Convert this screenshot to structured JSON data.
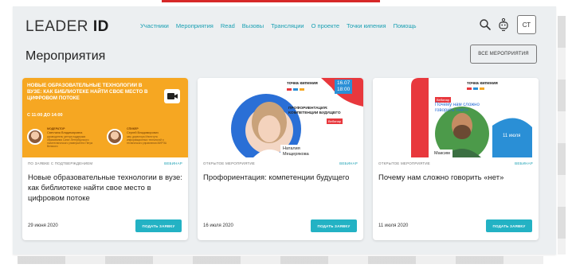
{
  "header": {
    "logo_main": "LEADER",
    "logo_accent": "ID",
    "nav": [
      "Участники",
      "Мероприятия",
      "Read",
      "Вызовы",
      "Трансляции",
      "О проекте",
      "Точки кипения",
      "Помощь"
    ],
    "avatar_initials": "СТ"
  },
  "page": {
    "title": "Мероприятия",
    "all_events_label": "ВСЕ МЕРОПРИЯТИЯ"
  },
  "cards": [
    {
      "meta_type": "ПО ЗАЯВКЕ С ПОДТВЕРЖДЕНИЕМ",
      "meta_format": "ВЕБИНАР",
      "title": "Новые образовательные технологии в вузе: как библиотеке найти свое место в цифровом потоке",
      "date": "29 июня 2020",
      "apply_label": "ПОДАТЬ ЗАЯВКУ",
      "banner": {
        "title": "НОВЫЕ ОБРАЗОВАТЕЛЬНЫЕ ТЕХНОЛОГИИ В ВУЗЕ: КАК БИБЛИОТЕКЕ НАЙТИ СВОЕ МЕСТО В ЦИФРОВОМ ПОТОКЕ",
        "time": "С 11:00 ДО 14:00",
        "speakers": [
          {
            "role": "МОДЕРАТОР",
            "name": "Светлана Владимировна",
            "desc": "руководитель центра поддержки образования Санкт-Петербургского политехнического университета Петра Великого"
          },
          {
            "role": "СПИКЕР",
            "name": "Сергей Владимирович",
            "desc": "зам. директора Института информационных технологий и технического управления МИРЭА"
          }
        ]
      }
    },
    {
      "meta_type": "ОТКРЫТОЕ МЕРОПРИЯТИЕ",
      "meta_format": "ВЕБИНАР",
      "title": "Профориентация: компетенции будущего",
      "date": "16 июля 2020",
      "apply_label": "ПОДАТЬ ЗАЯВКУ",
      "banner": {
        "logo": "точка кипения",
        "date": "16.07",
        "time": "18:00",
        "title": "ПРОФОРИЕНТАЦИЯ: КОМПЕТЕНЦИИ БУДУЩЕГО",
        "tag": "Вебинар",
        "speaker": "Наталия Мещерякова"
      }
    },
    {
      "meta_type": "ОТКРЫТОЕ МЕРОПРИЯТИЕ",
      "meta_format": "ВЕБИНАР",
      "title": "Почему нам сложно говорить «нет»",
      "date": "11 июля 2020",
      "apply_label": "ПОДАТЬ ЗАЯВКУ",
      "banner": {
        "logo": "точка кипения",
        "tag": "Вебинар",
        "title": "Почему нам сложно говорить «нет»",
        "speaker": "Максим",
        "date": "11 июля"
      }
    }
  ],
  "colors": {
    "accent": "#23b2c4",
    "nav_link": "#1aa0b3",
    "orange": "#f6a722",
    "blue": "#2a8fd6",
    "red": "#e8383d"
  }
}
